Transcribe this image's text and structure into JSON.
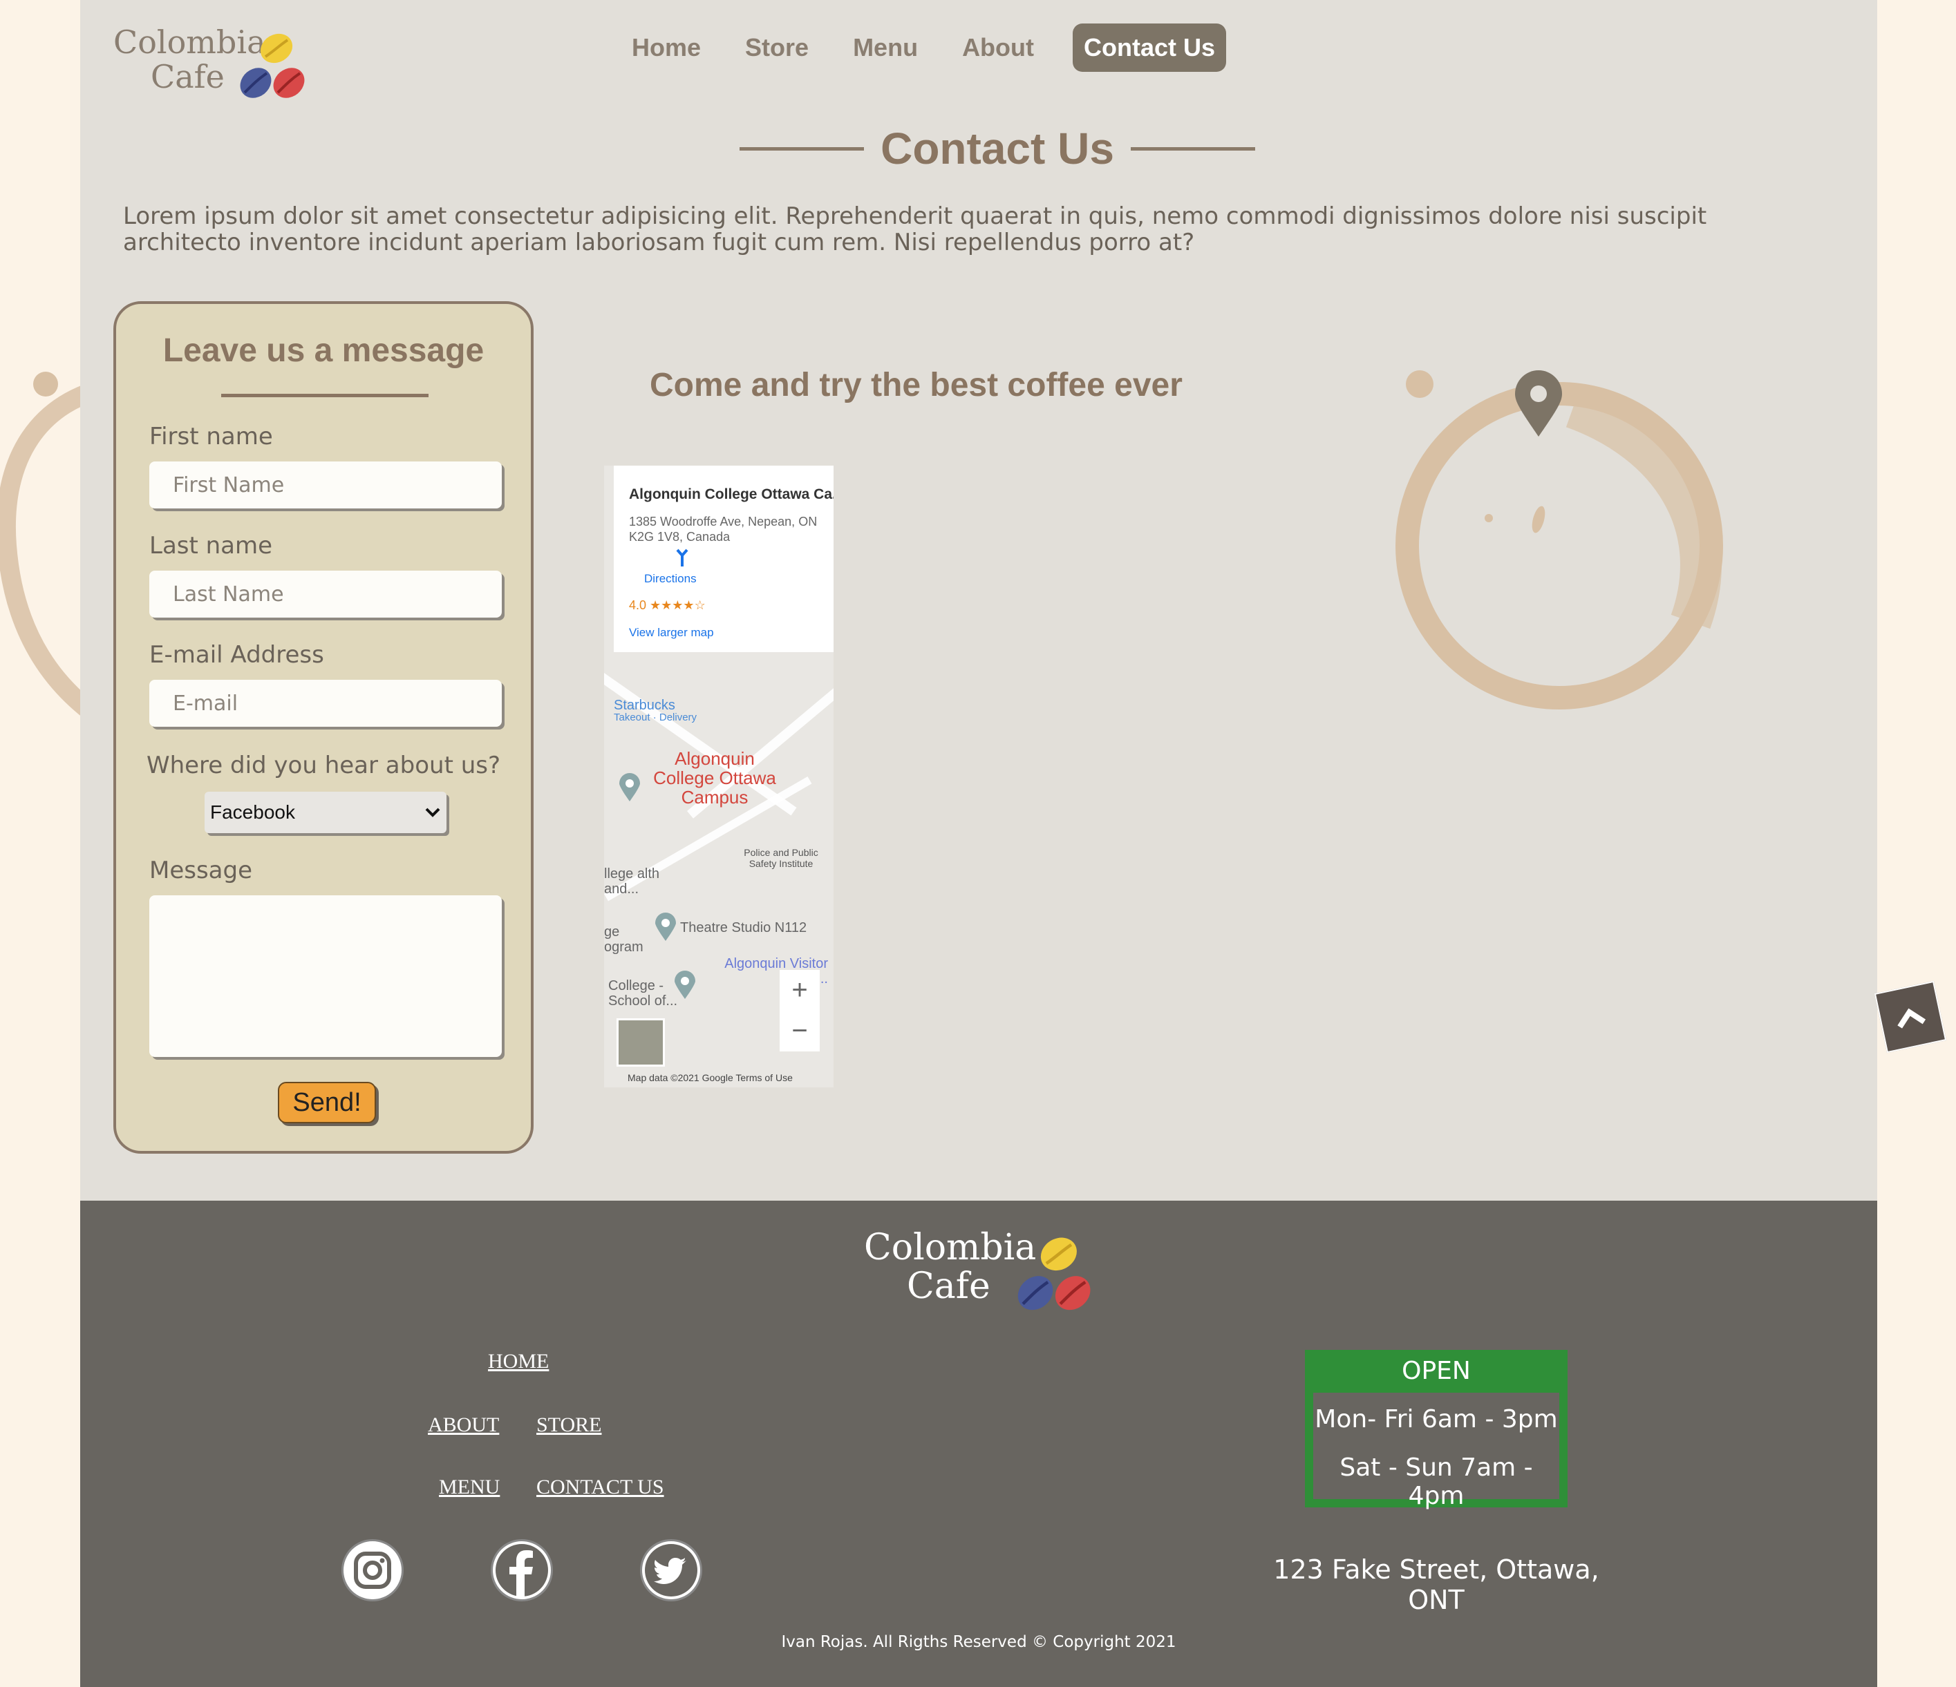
{
  "brand": {
    "line1": "Colombia",
    "line2": "Cafe"
  },
  "nav": {
    "items": [
      {
        "label": "Home"
      },
      {
        "label": "Store"
      },
      {
        "label": "Menu"
      },
      {
        "label": "About"
      },
      {
        "label": "Contact Us",
        "active": true
      }
    ]
  },
  "page": {
    "title": "Contact Us",
    "intro": "Lorem ipsum dolor sit amet consectetur adipisicing elit. Reprehenderit quaerat in quis, nemo commodi dignissimos dolore nisi suscipit architecto inventore incidunt aperiam laboriosam fugit cum rem. Nisi repellendus porro at?"
  },
  "form": {
    "title": "Leave us a message",
    "first_name": {
      "label": "First name",
      "placeholder": "First Name"
    },
    "last_name": {
      "label": "Last name",
      "placeholder": "Last Name"
    },
    "email": {
      "label": "E-mail Address",
      "placeholder": "E-mail"
    },
    "hear": {
      "label": "Where did you hear about us?",
      "selected": "Facebook"
    },
    "message": {
      "label": "Message"
    },
    "send_label": "Send!"
  },
  "location": {
    "heading": "Come and try the best coffee ever",
    "map": {
      "place": "Algonquin College Ottawa Ca...",
      "address_line1": "1385 Woodroffe Ave, Nepean, ON",
      "address_line2": "K2G 1V8, Canada",
      "directions": "Directions",
      "rating": "4.0 ★★★★☆",
      "larger_map": "View larger map",
      "starbucks": "Starbucks",
      "starbucks_sub": "Takeout · Delivery",
      "campus": "Algonquin College Ottawa Campus",
      "police": "Police and Public Safety Institute",
      "theatre": "Theatre Studio N112",
      "visitor": "Algonquin Visitor Pa...",
      "college_a": "College - School of...",
      "college_b": "llege alth and...",
      "college_c": "ge ogram",
      "attribution": "Map data ©2021 Google   Terms of Use",
      "zoom_in": "+",
      "zoom_out": "−"
    }
  },
  "footer": {
    "links": {
      "home": "HOME",
      "about": "ABOUT",
      "store": "STORE",
      "menu": "MENU",
      "contact": "CONTACT US"
    },
    "social": [
      "instagram-icon",
      "facebook-icon",
      "twitter-icon"
    ],
    "hours": {
      "status": "OPEN",
      "weekdays": "Mon- Fri 6am - 3pm",
      "weekend": "Sat - Sun 7am - 4pm"
    },
    "address": "123 Fake Street, Ottawa, ONT",
    "copyright": "Ivan Rojas. All Rigths Reserved © Copyright 2021"
  },
  "colors": {
    "accent": "#8a7561",
    "footer": "#686560",
    "open": "#2f8f38",
    "send": "#f0a23a"
  }
}
